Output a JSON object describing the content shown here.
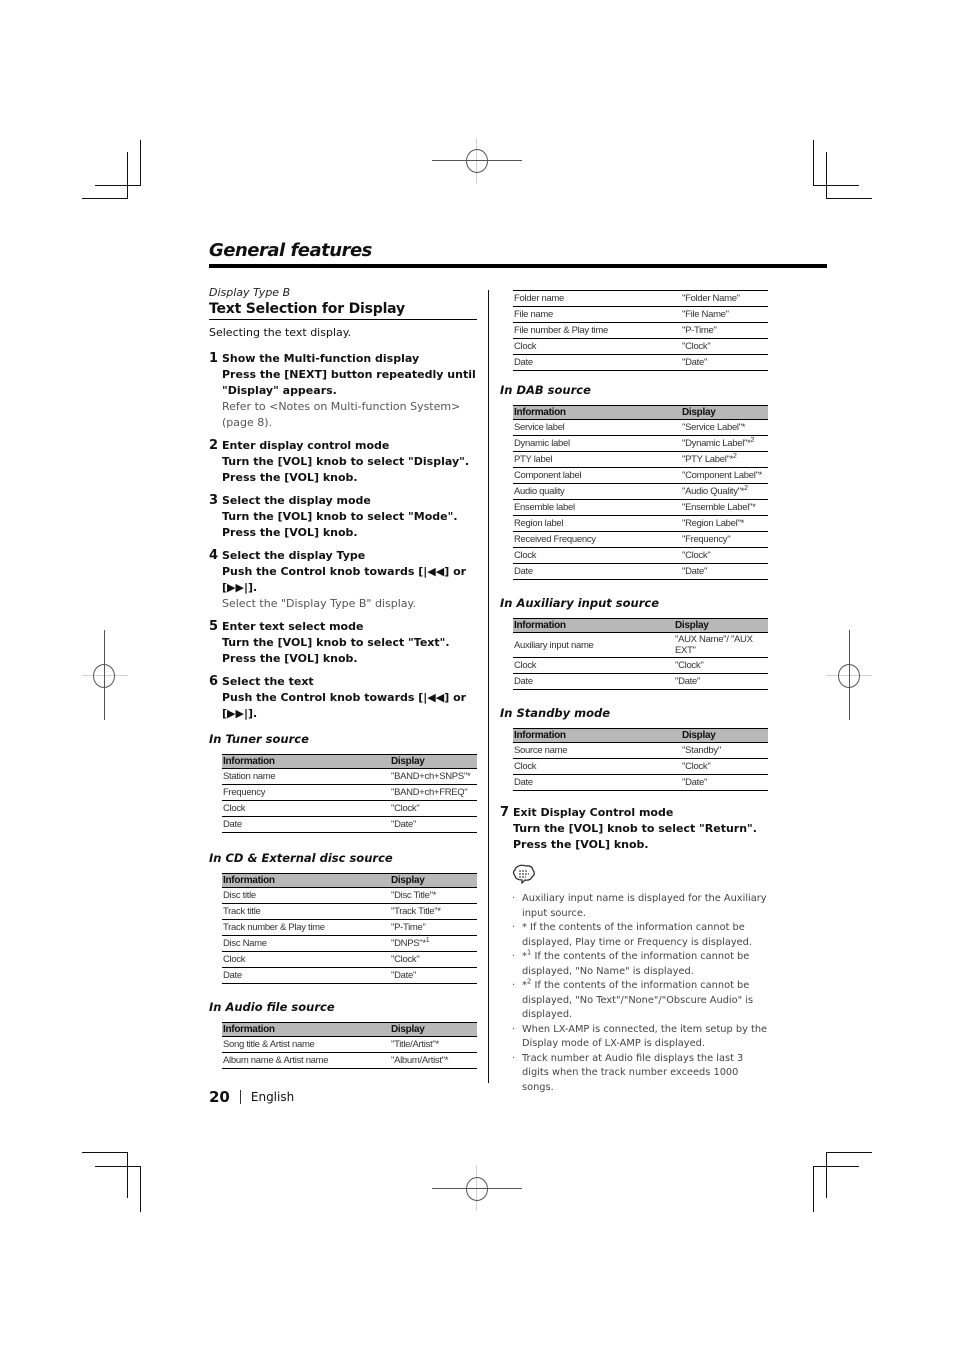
{
  "header": {
    "title": "General features"
  },
  "section": {
    "subtitle": "Display Type B",
    "heading": "Text Selection for Display",
    "intro": "Selecting the text display."
  },
  "steps": [
    {
      "num": "1",
      "title": "Show the Multi-function display",
      "instr": "Press the [NEXT] button repeatedly until \"Display\" appears.",
      "note": "Refer to <Notes on Multi-function System> (page 8)."
    },
    {
      "num": "2",
      "title": "Enter display control mode",
      "instr": "Turn the [VOL] knob to select \"Display\". Press the [VOL] knob.",
      "note": ""
    },
    {
      "num": "3",
      "title": "Select the display mode",
      "instr": "Turn the [VOL] knob to select \"Mode\". Press the [VOL] knob.",
      "note": ""
    },
    {
      "num": "4",
      "title": "Select the display Type",
      "instr": "Push the Control knob towards [|◀◀] or [▶▶|].",
      "note": "Select the \"Display Type B\" display."
    },
    {
      "num": "5",
      "title": "Enter text select mode",
      "instr": "Turn the [VOL] knob to select \"Text\". Press the [VOL] knob.",
      "note": ""
    },
    {
      "num": "6",
      "title": "Select the text",
      "instr": "Push the Control knob towards [|◀◀] or [▶▶|].",
      "note": ""
    },
    {
      "num": "7",
      "title": "Exit Display Control mode",
      "instr": "Turn the [VOL] knob to select \"Return\". Press the [VOL] knob.",
      "note": ""
    }
  ],
  "table_headers": {
    "info": "Information",
    "display": "Display"
  },
  "sources": {
    "tuner": {
      "heading": "In Tuner source",
      "rows": [
        {
          "info": "Station name",
          "display": "\"BAND+ch+SNPS\"*"
        },
        {
          "info": "Frequency",
          "display": "\"BAND+ch+FREQ\""
        },
        {
          "info": "Clock",
          "display": "\"Clock\""
        },
        {
          "info": "Date",
          "display": "\"Date\""
        }
      ]
    },
    "cd": {
      "heading": "In CD & External disc source",
      "rows": [
        {
          "info": "Disc title",
          "display": "\"Disc Title\"*"
        },
        {
          "info": "Track title",
          "display": "\"Track Title\"*"
        },
        {
          "info": "Track number & Play time",
          "display": "\"P-Time\""
        },
        {
          "info": "Disc Name",
          "display": "\"DNPS\"*",
          "sup": "1"
        },
        {
          "info": "Clock",
          "display": "\"Clock\""
        },
        {
          "info": "Date",
          "display": "\"Date\""
        }
      ]
    },
    "audio_file": {
      "heading": "In Audio file source",
      "rows": [
        {
          "info": "Song title & Artist name",
          "display": "\"Title/Artist\"*"
        },
        {
          "info": "Album name & Artist name",
          "display": "\"Album/Artist\"*"
        }
      ],
      "rows_continued": [
        {
          "info": "Folder name",
          "display": "\"Folder Name\""
        },
        {
          "info": "File name",
          "display": "\"File Name\""
        },
        {
          "info": "File number & Play time",
          "display": "\"P-Time\""
        },
        {
          "info": "Clock",
          "display": "\"Clock\""
        },
        {
          "info": "Date",
          "display": "\"Date\""
        }
      ]
    },
    "dab": {
      "heading": "In DAB source",
      "rows": [
        {
          "info": "Service label",
          "display": "\"Service Label\"*"
        },
        {
          "info": "Dynamic label",
          "display": "\"Dynamic Label\"*",
          "sup": "2"
        },
        {
          "info": "PTY label",
          "display": "\"PTY Label\"*",
          "sup": "2"
        },
        {
          "info": "Component label",
          "display": "\"Component Label\"*"
        },
        {
          "info": "Audio quality",
          "display": "\"Audio Quality\"*",
          "sup": "2"
        },
        {
          "info": "Ensemble label",
          "display": "\"Ensemble Label\"*"
        },
        {
          "info": "Region label",
          "display": "\"Region Label\"*"
        },
        {
          "info": "Received Frequency",
          "display": "\"Frequency\""
        },
        {
          "info": "Clock",
          "display": "\"Clock\""
        },
        {
          "info": "Date",
          "display": "\"Date\""
        }
      ]
    },
    "aux": {
      "heading": "In Auxiliary input source",
      "rows": [
        {
          "info": "Auxiliary input name",
          "display": "\"AUX Name\"/ \"AUX EXT\""
        },
        {
          "info": "Clock",
          "display": "\"Clock\""
        },
        {
          "info": "Date",
          "display": "\"Date\""
        }
      ]
    },
    "standby": {
      "heading": "In Standby mode",
      "rows": [
        {
          "info": "Source name",
          "display": "\"Standby\""
        },
        {
          "info": "Clock",
          "display": "\"Clock\""
        },
        {
          "info": "Date",
          "display": "\"Date\""
        }
      ]
    }
  },
  "notes": {
    "icon": "memo-speech-bubble-icon",
    "items": [
      {
        "mark": "",
        "text": "Auxiliary input name is displayed for the Auxiliary input source."
      },
      {
        "mark": "*",
        "text": " If the contents of the information cannot be displayed, Play time or Frequency is displayed."
      },
      {
        "mark": "*1",
        "text": " If the contents of the information cannot be displayed, \"No Name\" is displayed."
      },
      {
        "mark": "*2",
        "text": " If the contents of the information cannot be displayed, \"No Text\"/\"None\"/\"Obscure Audio\" is displayed."
      },
      {
        "mark": "",
        "text": "When LX-AMP is connected, the item setup by the Display mode of LX-AMP is displayed."
      },
      {
        "mark": "",
        "text": "Track number at Audio file displays the last 3 digits when the track number exceeds 1000 songs."
      }
    ]
  },
  "footer": {
    "page_number": "20",
    "language": "English"
  }
}
